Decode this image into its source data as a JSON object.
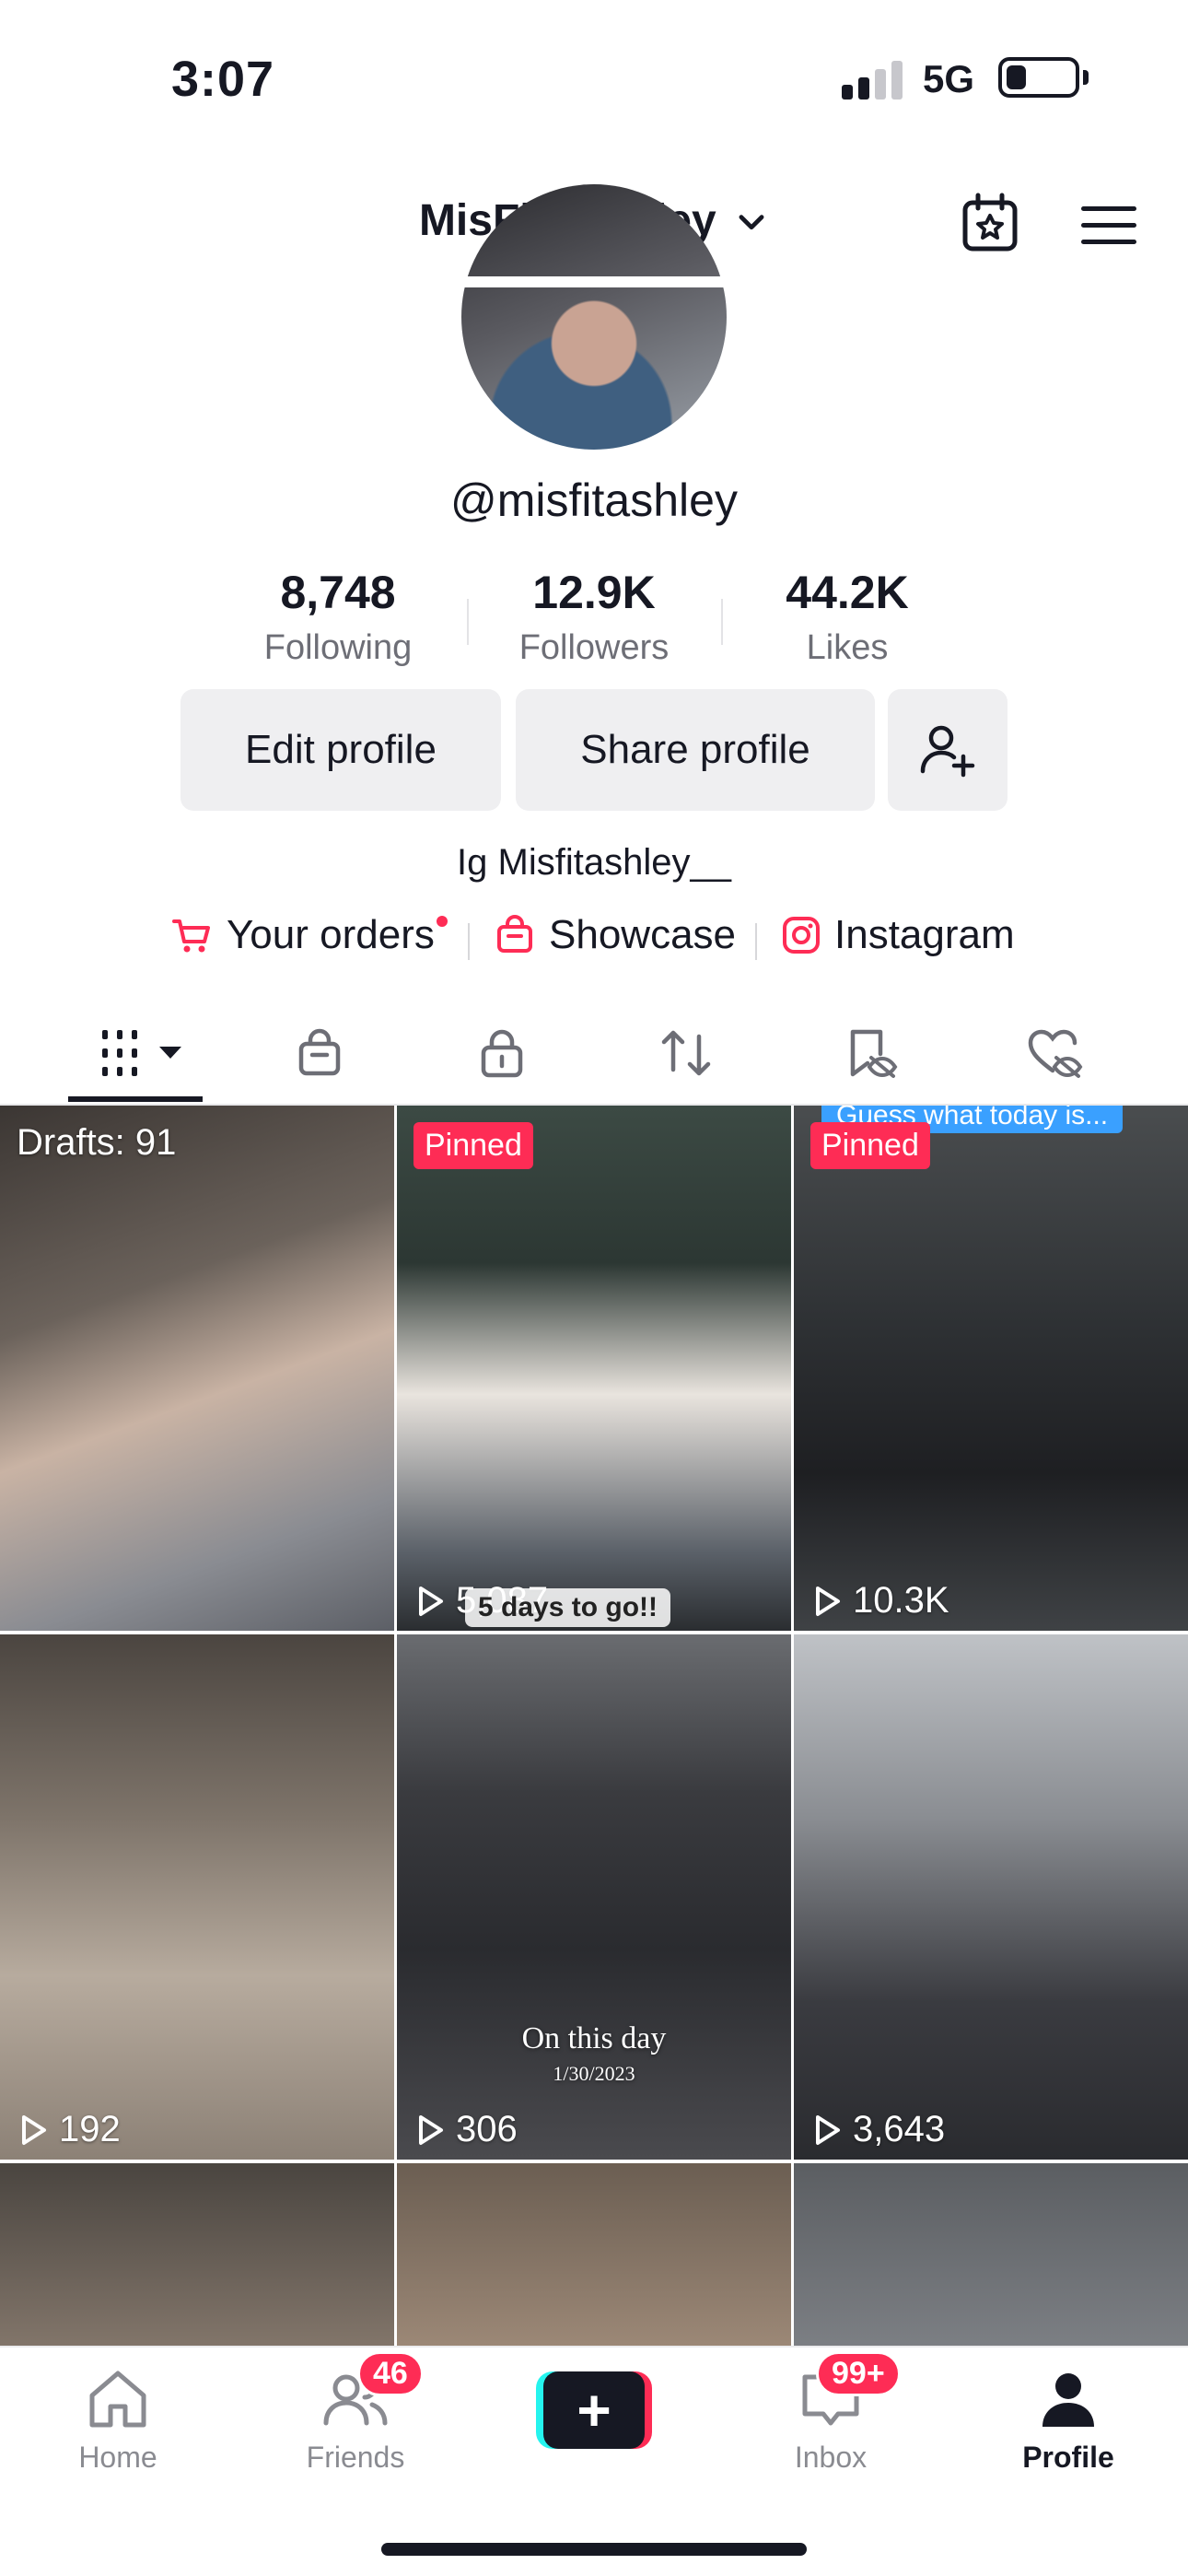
{
  "status_bar": {
    "time": "3:07",
    "network": "5G",
    "battery_level": 0.3
  },
  "header": {
    "username": "MisFit_Ashley"
  },
  "profile": {
    "handle": "@misfitashley",
    "stats": [
      {
        "value": "8,748",
        "label": "Following"
      },
      {
        "value": "12.9K",
        "label": "Followers"
      },
      {
        "value": "44.2K",
        "label": "Likes"
      }
    ],
    "buttons": {
      "edit": "Edit profile",
      "share": "Share profile"
    },
    "bio": "Ig Misfitashley__",
    "links": {
      "orders": "Your orders",
      "showcase": "Showcase",
      "instagram": "Instagram"
    }
  },
  "tabs": [
    "videos-grid",
    "shop",
    "private",
    "reposts",
    "favorites-hidden",
    "liked-hidden"
  ],
  "videos": [
    {
      "overlay": "Drafts: 91"
    },
    {
      "badge": "Pinned",
      "sticker": "5 days to go!!",
      "views": "5,087"
    },
    {
      "badge": "Pinned",
      "top_caption": "Guess what today is...",
      "views": "10.3K"
    },
    {
      "views": "192"
    },
    {
      "views": "306",
      "caption_line1": "On this day",
      "caption_line2": "1/30/2023"
    },
    {
      "views": "3,643"
    },
    {},
    {},
    {}
  ],
  "bottom_nav": {
    "home": "Home",
    "friends": "Friends",
    "friends_badge": "46",
    "create": "+",
    "inbox": "Inbox",
    "inbox_badge": "99+",
    "profile": "Profile"
  },
  "colors": {
    "accent": "#fe2c55",
    "cyan": "#25f4ee",
    "text": "#161823"
  }
}
